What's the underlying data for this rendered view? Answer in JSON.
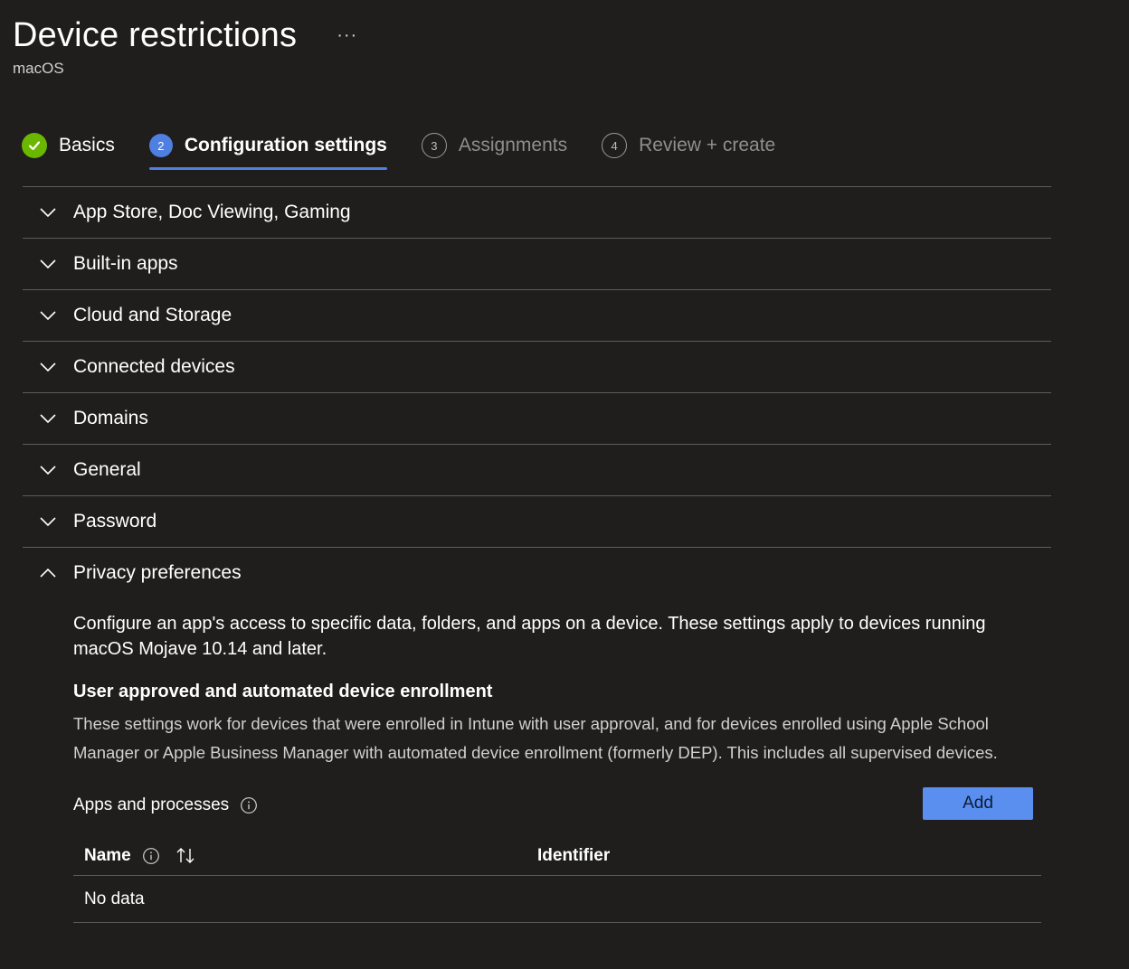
{
  "header": {
    "title": "Device restrictions",
    "more_label": "···",
    "subtitle": "macOS"
  },
  "wizard": {
    "steps": [
      {
        "number": "1",
        "label": "Basics",
        "state": "completed"
      },
      {
        "number": "2",
        "label": "Configuration settings",
        "state": "current"
      },
      {
        "number": "3",
        "label": "Assignments",
        "state": "pending"
      },
      {
        "number": "4",
        "label": "Review + create",
        "state": "pending"
      }
    ]
  },
  "sections": [
    {
      "label": "App Store, Doc Viewing, Gaming",
      "expanded": false
    },
    {
      "label": "Built-in apps",
      "expanded": false
    },
    {
      "label": "Cloud and Storage",
      "expanded": false
    },
    {
      "label": "Connected devices",
      "expanded": false
    },
    {
      "label": "Domains",
      "expanded": false
    },
    {
      "label": "General",
      "expanded": false
    },
    {
      "label": "Password",
      "expanded": false
    },
    {
      "label": "Privacy preferences",
      "expanded": true
    }
  ],
  "privacy": {
    "intro": "Configure an app's access to specific data, folders, and apps on a device. These settings apply to devices running macOS Mojave 10.14 and later.",
    "heading": "User approved and automated device enrollment",
    "description": "These settings work for devices that were enrolled in Intune with user approval, and for devices enrolled using Apple School Manager or Apple Business Manager with automated device enrollment (formerly DEP). This includes all supervised devices.",
    "apps_label": "Apps and processes",
    "add_label": "Add",
    "table": {
      "columns": [
        "Name",
        "Identifier"
      ],
      "empty_text": "No data"
    }
  },
  "colors": {
    "background": "#1f1e1d",
    "accent": "#4f7fe0",
    "success": "#6bb700",
    "button": "#5a8ff0"
  },
  "icons": {
    "step_done": "checkmark-icon",
    "collapsed": "chevron-down-icon",
    "expanded": "chevron-up-icon",
    "info": "info-icon",
    "sort": "sort-arrows-icon"
  }
}
